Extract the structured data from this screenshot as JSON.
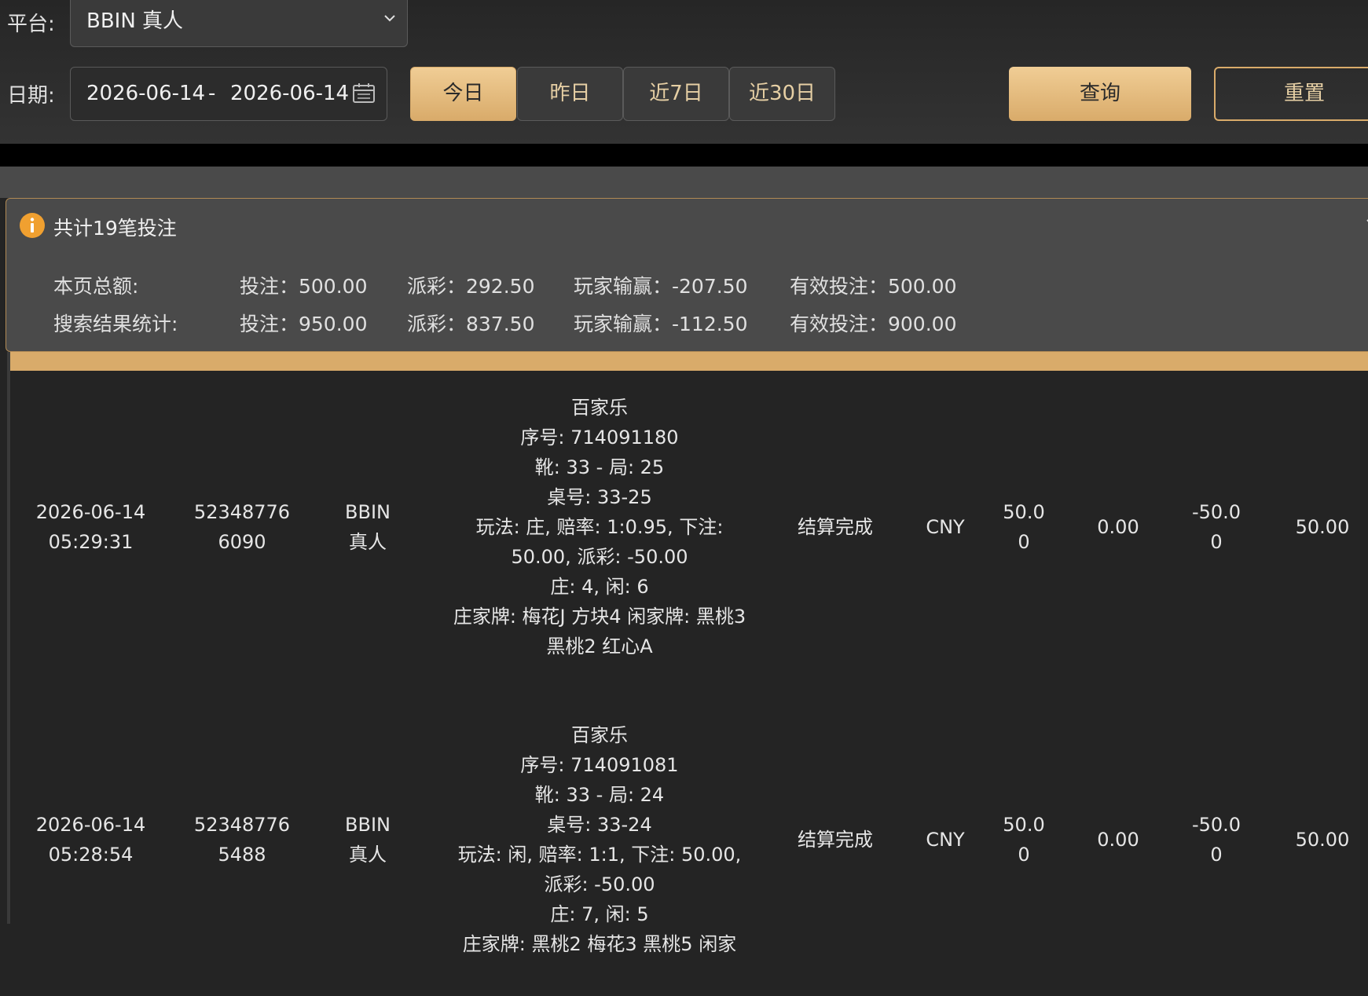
{
  "filters": {
    "platform_label": "平台:",
    "platform_value": "BBIN 真人",
    "date_label": "日期:",
    "date_start": "2026-06-14",
    "date_sep": "-",
    "date_end": "2026-06-14",
    "quick_ranges": [
      "今日",
      "昨日",
      "近7日",
      "近30日"
    ],
    "active_range": "今日",
    "query_label": "查询",
    "reset_label": "重置"
  },
  "summary": {
    "title": "共计19笔投注",
    "page_total": {
      "label": "本页总额:",
      "bet": "投注：500.00",
      "payout": "派彩：292.50",
      "player_win_loss": "玩家输赢：-207.50",
      "valid_bet": "有效投注：500.00"
    },
    "search_total": {
      "label": "搜索结果统计:",
      "bet": "投注：950.00",
      "payout": "派彩：837.50",
      "player_win_loss": "玩家输赢：-112.50",
      "valid_bet": "有效投注：900.00"
    }
  },
  "rows": [
    {
      "date": "2026-06-14",
      "time": "05:29:31",
      "order_a": "52348776",
      "order_b": "6090",
      "platform_a": "BBIN",
      "platform_b": "真人",
      "detail": [
        "百家乐",
        "序号: 714091180",
        "靴: 33 - 局: 25",
        "桌号: 33-25",
        "玩法: 庄, 赔率: 1:0.95, 下注: 50.00, 派彩: -50.00",
        "庄: 4, 闲: 6",
        "庄家牌: 梅花J 方块4 闲家牌: 黑桃3 黑桃2 红心A"
      ],
      "status": "结算完成",
      "currency": "CNY",
      "bet_a": "50.0",
      "bet_b": "0",
      "payout": "0.00",
      "winloss_a": "-50.0",
      "winloss_b": "0",
      "valid_bet": "50.00"
    },
    {
      "date": "2026-06-14",
      "time": "05:28:54",
      "order_a": "52348776",
      "order_b": "5488",
      "platform_a": "BBIN",
      "platform_b": "真人",
      "detail": [
        "百家乐",
        "序号: 714091081",
        "靴: 33 - 局: 24",
        "桌号: 33-24",
        "玩法: 闲, 赔率: 1:1, 下注: 50.00, 派彩: -50.00",
        "庄: 7, 闲: 5",
        "庄家牌: 黑桃2 梅花3 黑桃5 闲家"
      ],
      "status": "结算完成",
      "currency": "CNY",
      "bet_a": "50.0",
      "bet_b": "0",
      "payout": "0.00",
      "winloss_a": "-50.0",
      "winloss_b": "0",
      "valid_bet": "50.00"
    }
  ],
  "icons": {
    "dropdown": "chevron-down-icon",
    "calendar": "calendar-icon",
    "info": "info-icon",
    "collapse": "chevron-collapse-icon"
  },
  "colors": {
    "accent_gold": "#d9ab6a",
    "info_orange": "#f0a030",
    "background": "#242424"
  }
}
